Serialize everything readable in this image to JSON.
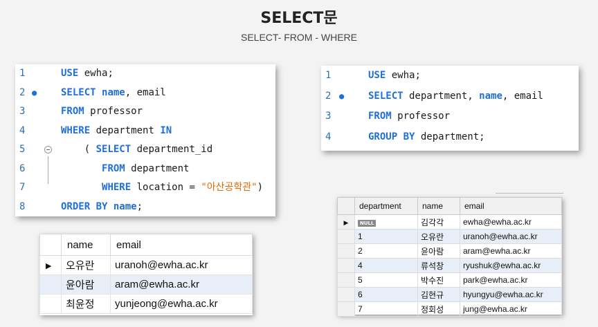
{
  "header": {
    "title": "SELECT문",
    "subtitle": "SELECT- FROM - WHERE"
  },
  "editor_left": {
    "lines": [
      {
        "num": "1",
        "parts": [
          {
            "t": "USE",
            "kw": true
          },
          {
            "t": " ewha;"
          }
        ]
      },
      {
        "num": "2",
        "bp": true,
        "parts": [
          {
            "t": "SELECT",
            "kw": true
          },
          {
            "t": " "
          },
          {
            "t": "name",
            "kw": true
          },
          {
            "t": ", email"
          }
        ]
      },
      {
        "num": "3",
        "parts": [
          {
            "t": "FROM",
            "kw": true
          },
          {
            "t": " professor"
          }
        ]
      },
      {
        "num": "4",
        "parts": [
          {
            "t": "WHERE",
            "kw": true
          },
          {
            "t": " department "
          },
          {
            "t": "IN",
            "kw": true
          }
        ]
      },
      {
        "num": "5",
        "fold": true,
        "parts": [
          {
            "t": "    ( "
          },
          {
            "t": "SELECT",
            "kw": true
          },
          {
            "t": " department_id"
          }
        ]
      },
      {
        "num": "6",
        "parts": [
          {
            "t": "       "
          },
          {
            "t": "FROM",
            "kw": true
          },
          {
            "t": " department"
          }
        ]
      },
      {
        "num": "7",
        "parts": [
          {
            "t": "       "
          },
          {
            "t": "WHERE",
            "kw": true
          },
          {
            "t": " location = "
          },
          {
            "t": "\"아산공학관\"",
            "str": true
          },
          {
            "t": ")"
          }
        ]
      },
      {
        "num": "8",
        "parts": [
          {
            "t": "ORDER BY",
            "kw": true
          },
          {
            "t": " "
          },
          {
            "t": "name",
            "kw": true
          },
          {
            "t": ";"
          }
        ]
      }
    ]
  },
  "editor_right": {
    "lines": [
      {
        "num": "1",
        "parts": [
          {
            "t": "USE",
            "kw": true
          },
          {
            "t": " ewha;"
          }
        ]
      },
      {
        "num": "2",
        "bp": true,
        "parts": [
          {
            "t": "SELECT",
            "kw": true
          },
          {
            "t": " department, "
          },
          {
            "t": "name",
            "kw": true
          },
          {
            "t": ", email"
          }
        ]
      },
      {
        "num": "3",
        "parts": [
          {
            "t": "FROM",
            "kw": true
          },
          {
            "t": " professor"
          }
        ]
      },
      {
        "num": "4",
        "parts": [
          {
            "t": "GROUP BY",
            "kw": true
          },
          {
            "t": " department;"
          }
        ]
      }
    ]
  },
  "result_left": {
    "columns": [
      "name",
      "email"
    ],
    "rows": [
      {
        "name": "오유란",
        "email": "uranoh@ewha.ac.kr",
        "current": true
      },
      {
        "name": "윤아람",
        "email": "aram@ewha.ac.kr",
        "alt": true
      },
      {
        "name": "최윤정",
        "email": "yunjeong@ewha.ac.kr"
      }
    ]
  },
  "result_right": {
    "columns": [
      "department",
      "name",
      "email"
    ],
    "null_label": "NULL",
    "rows": [
      {
        "department": null,
        "name": "김각각",
        "email": "ewha@ewha.ac.kr",
        "current": true
      },
      {
        "department": "1",
        "name": "오유란",
        "email": "uranoh@ewha.ac.kr",
        "alt": true
      },
      {
        "department": "2",
        "name": "윤아람",
        "email": "aram@ewha.ac.kr"
      },
      {
        "department": "4",
        "name": "류석창",
        "email": "ryushuk@ewha.ac.kr",
        "alt": true
      },
      {
        "department": "5",
        "name": "박수진",
        "email": "park@ewha.ac.kr"
      },
      {
        "department": "6",
        "name": "김현규",
        "email": "hyungyu@ewha.ac.kr",
        "alt": true
      },
      {
        "department": "7",
        "name": "정회성",
        "email": "jung@ewha.ac.kr"
      }
    ]
  },
  "colors": {
    "keyword": "#1f6fd8",
    "string": "#e06a00",
    "line_number": "#2c6fb2",
    "alt_row": "#e8eef8"
  }
}
